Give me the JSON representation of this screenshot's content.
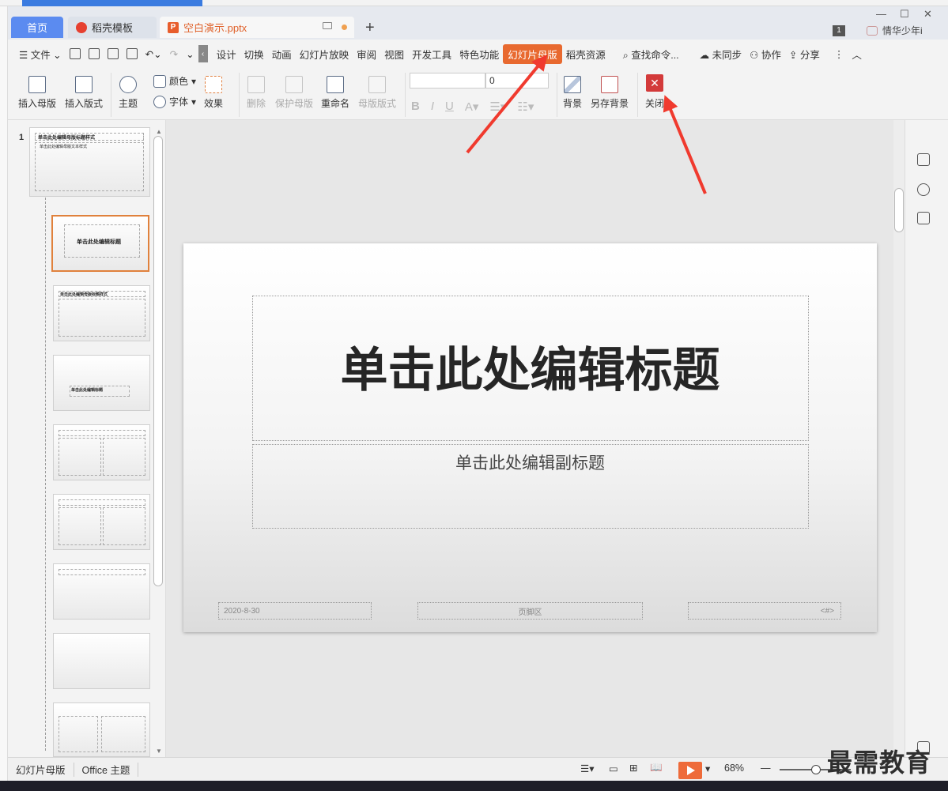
{
  "tabs": {
    "home": "首页",
    "templates": "稻壳模板",
    "document": "空白演示.pptx",
    "new_tab": "+"
  },
  "window": {
    "badge": "1",
    "user": "情华少年i",
    "minimize": "—",
    "maximize": "☐",
    "close": "✕"
  },
  "menu": {
    "file": "文件",
    "items": [
      "设计",
      "切换",
      "动画",
      "幻灯片放映",
      "审阅",
      "视图",
      "开发工具",
      "特色功能"
    ],
    "active": "幻灯片母版",
    "resources": "稻壳资源",
    "search": "查找命令...",
    "unsync": "未同步",
    "collab": "协作",
    "share": "分享"
  },
  "ribbon": {
    "insert_master": "插入母版",
    "insert_layout": "插入版式",
    "theme": "主题",
    "color": "颜色",
    "font": "字体",
    "effect": "效果",
    "delete": "删除",
    "protect_master": "保护母版",
    "rename": "重命名",
    "master_layout": "母版版式",
    "font_size": "0",
    "background": "背景",
    "save_background": "另存背景",
    "close": "关闭"
  },
  "thumbnails": {
    "slide_number": "1",
    "master_title": "单击此处编辑母版标题样式",
    "master_body": "单击此处编辑母版文本样式",
    "title_layout_title": "单击此处编辑标题",
    "layout_title": "单击此处编辑母版标题样式",
    "section_title": "单击此处编辑标题"
  },
  "slide": {
    "title": "单击此处编辑标题",
    "subtitle": "单击此处编辑副标题",
    "date": "2020-8-30",
    "footer": "页脚区",
    "number": "<#>"
  },
  "status": {
    "mode": "幻灯片母版",
    "theme": "Office 主题",
    "zoom": "68%",
    "zoom_minus": "—"
  },
  "watermark": "最需教育",
  "colors": {
    "accent": "#e8692f",
    "close_red": "#d33a3a",
    "home_tab": "#5b8bf0",
    "arrow": "#f03a2e"
  }
}
